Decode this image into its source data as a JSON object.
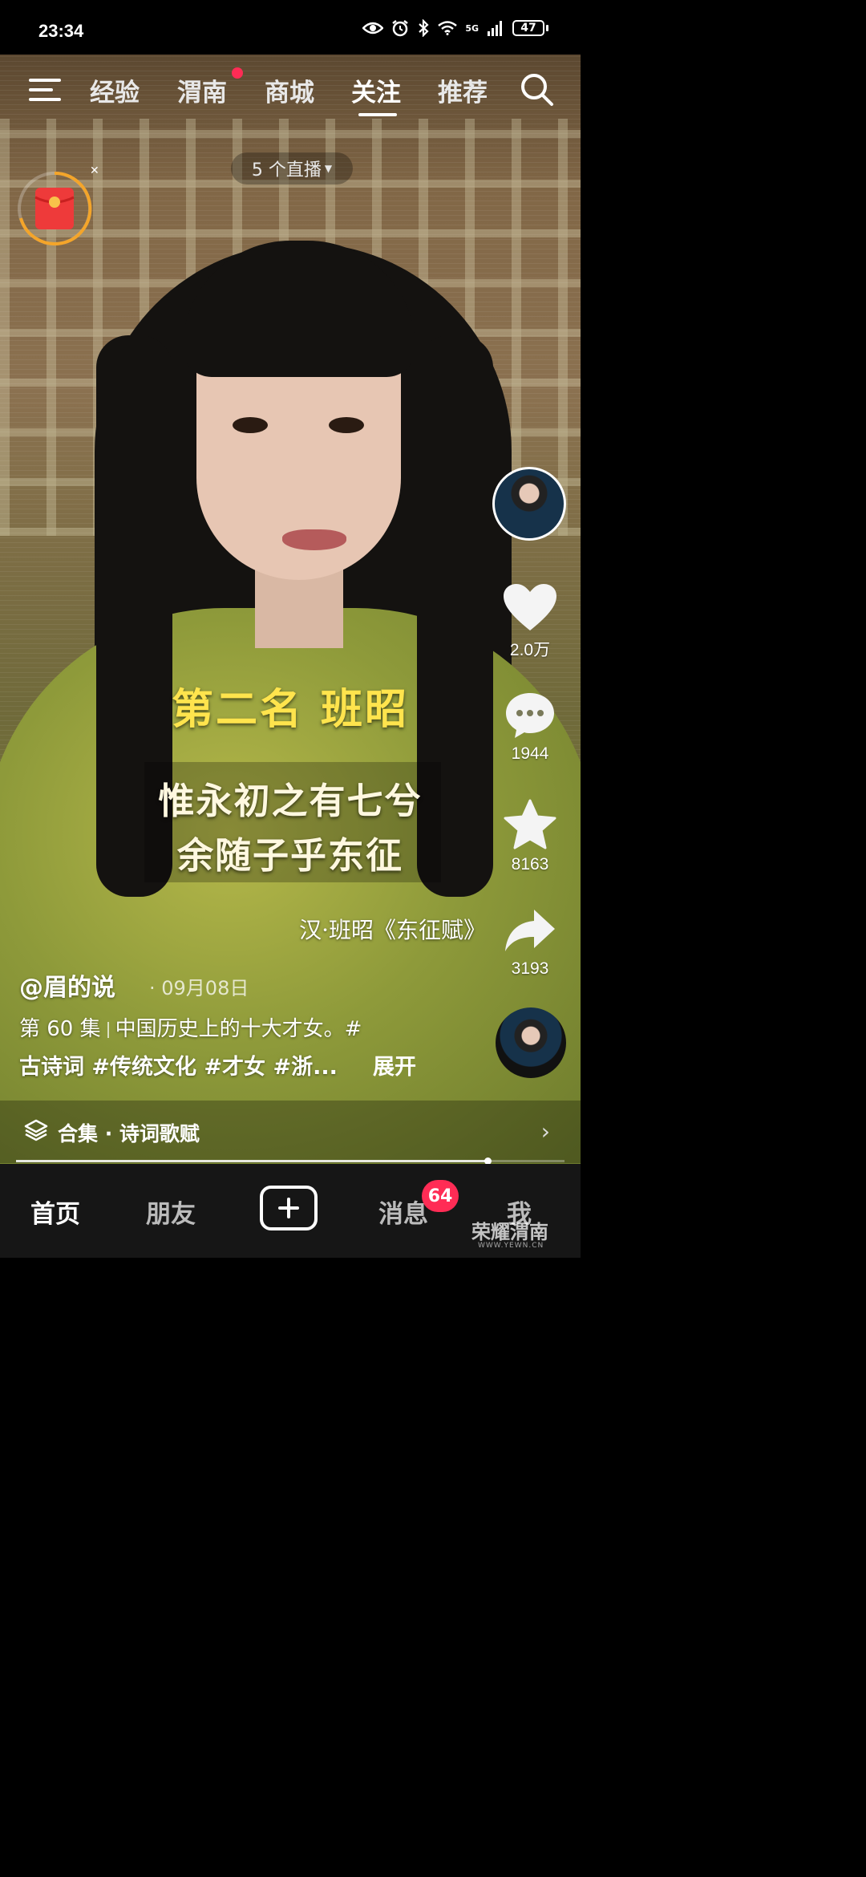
{
  "status_bar": {
    "time": "23:34",
    "network": "5G",
    "battery": "47"
  },
  "top_nav": {
    "tabs": [
      {
        "label": "经验"
      },
      {
        "label": "渭南",
        "has_dot": true
      },
      {
        "label": "商城"
      },
      {
        "label": "关注",
        "active": true
      },
      {
        "label": "推荐"
      }
    ]
  },
  "live_pill": {
    "label": "5 个直播"
  },
  "video": {
    "caption_main": "第二名 班昭",
    "caption_line1": "惟永初之有七兮",
    "caption_line2": "余随子乎东征",
    "source": "汉·班昭《东征赋》",
    "playback_progress": 0.86
  },
  "right_rail": {
    "likes": "2.0万",
    "comments": "1944",
    "favorites": "8163",
    "shares": "3193"
  },
  "post": {
    "author": "@眉的说",
    "date": "· 09月08日",
    "episode": "第 60 集",
    "desc_line1": "中国历史上的十大才女。#",
    "desc_line2": "古诗词 #传统文化 #才女 #浙...",
    "expand_label": "展开"
  },
  "collection": {
    "label": "合集 · 诗词歌赋"
  },
  "bottom_nav": {
    "home": "首页",
    "friends": "朋友",
    "messages": "消息",
    "messages_badge": "64",
    "me": "我"
  },
  "watermark": {
    "text": "荣耀渭南",
    "sub": "WWW.YEWN.CN"
  },
  "colors": {
    "accent_red": "#ff2c55",
    "caption_yellow": "#ffe44d",
    "nav_bg": "#161616"
  }
}
